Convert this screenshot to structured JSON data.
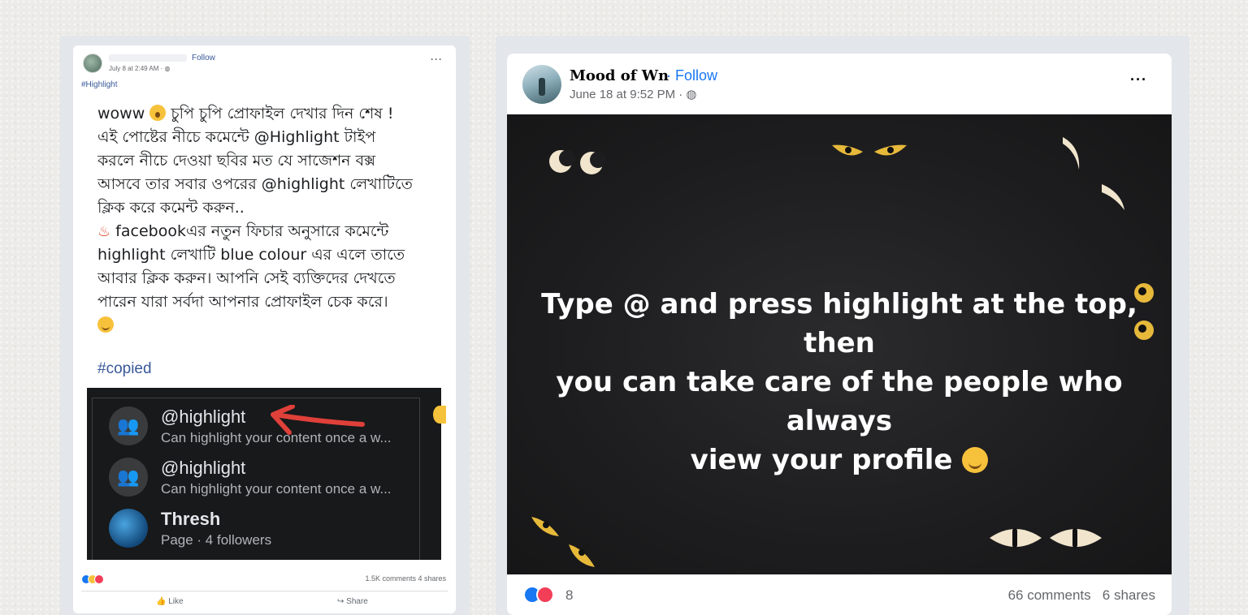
{
  "left_post": {
    "follow": "Follow",
    "date": "July 8 at 2:49 AM · ",
    "more": "···",
    "hashtag_header": "#Highlight",
    "body": {
      "line1_a": "woww ",
      "line1_b": " চুপি চুপি প্রোফাইল দেখার দিন শেষ !",
      "line2": "এই পোষ্টের নীচে কমেন্টে @Highlight টাইপ",
      "line3": "করলে নীচে দেওয়া ছবির মত যে সাজেশন বক্স",
      "line4": "আসবে তার সবার ওপরের @highlight  লেখাটিতে",
      "line5": "ক্লিক করে কমেন্ট করুন..",
      "line6_icon": "♨",
      "line6": " facebookএর নতুন ফিচার অনুসারে কমেন্টে",
      "line7": "highlight লেখাটি blue colour এর এলে তাতে",
      "line8": "আবার ক্লিক করুন।  আপনি সেই ব্যক্তিদের দেখতে",
      "line9": "পারেন যারা সর্বদা আপনার প্রোফাইল চেক করে।"
    },
    "hashtag_copied": "#copied",
    "suggestions": [
      {
        "title": "@highlight",
        "subtitle": "Can highlight your content once a w...",
        "icon": "group-icon"
      },
      {
        "title": "@highlight",
        "subtitle": "Can highlight your content once a w...",
        "icon": "group-icon"
      },
      {
        "title": "Thresh",
        "subtitle": "Page · 4 followers",
        "icon": "page-avatar"
      }
    ],
    "counts": "1.5K comments  4 shares",
    "like_label": "Like",
    "share_label": "Share",
    "colors": {
      "link": "#385898",
      "arrow": "#e0403a"
    }
  },
  "right_post": {
    "name": "Mood of Wn",
    "follow": "· Follow",
    "date": "June 18 at 9:52 PM · ",
    "more": "···",
    "image_text": {
      "line1": "Type @ and press highlight at the top, then",
      "line2": "you can take care of the people who always",
      "line3": "view your profile "
    },
    "reaction_count": "8",
    "comments": "66 comments",
    "shares": "6 shares",
    "colors": {
      "follow": "#1877f2",
      "like": "#1877f2",
      "love": "#f33e58"
    }
  }
}
